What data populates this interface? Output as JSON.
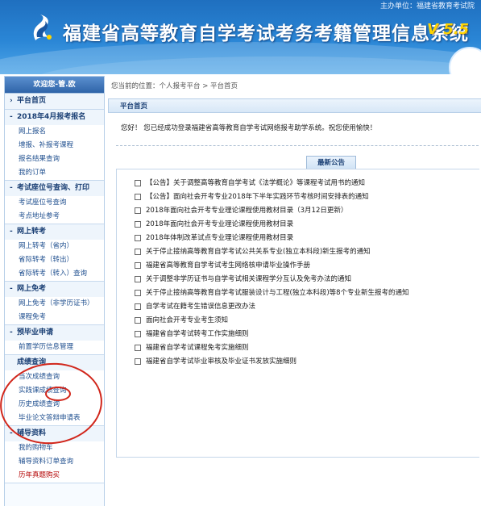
{
  "header": {
    "sponsor": "主办单位：福建省教育考试院",
    "title": "福建省高等教育自学考试考务考籍管理信息系统",
    "version": "V 5.5"
  },
  "sidebar": {
    "welcome": "欢迎您-管.欧",
    "groups": [
      {
        "title": "平台首页",
        "items": []
      },
      {
        "title": "2018年4月报考报名",
        "items": [
          "网上报名",
          "增报、补报考课程",
          "报名结果查询",
          "我的订单"
        ]
      },
      {
        "title": "考试座位号查询、打印",
        "items": [
          "考试座位号查询",
          "考点地址参考"
        ]
      },
      {
        "title": "网上转考",
        "items": [
          "网上转考（省内）",
          "省际转考（转出）",
          "省际转考（转入）查询"
        ]
      },
      {
        "title": "网上免考",
        "items": [
          "网上免考（非学历证书）",
          "课程免考"
        ]
      },
      {
        "title": "预毕业申请",
        "items": [
          "前置学历信息管理"
        ]
      },
      {
        "title": "成绩查询",
        "items": [
          "当次成绩查询",
          "实践课成绩查询",
          "历史成绩查询",
          "毕业论文答辩申请表"
        ]
      },
      {
        "title": "辅导资料",
        "items": [
          "我的购物车",
          "辅导资料订单查询",
          "历年真题购买"
        ]
      }
    ]
  },
  "main": {
    "breadcrumb": "您当前的位置：个人报考平台 > 平台首页",
    "tab_title": "平台首页",
    "welcome_message": "您好！ 您已经成功登录福建省高等教育自学考试网络报考助学系统。祝您使用愉快！",
    "notice_title": "最新公告",
    "notices": [
      "【公告】关于调整高等教育自学考试《法学概论》等课程考试用书的通知",
      "【公告】面向社会开考专业2018年下半年实践环节考核时间安排表的通知",
      "2018年面向社会开考专业理论课程使用教材目录（3月12日更新）",
      "2018年面向社会开考专业理论课程使用教材目录",
      "2018年体制改革试点专业理论课程使用教材目录",
      "关于停止接纳高等教育自学考试公共关系专业(独立本科段)新生报考的通知",
      "福建省高等教育自学考试考生网络核申请毕业操作手册",
      "关于调整非学历证书与自学考试相关课程学分互认及免考办法的通知",
      "关于停止接纳高等教育自学考试服装设计与工程(独立本科段)等8个专业新生报考的通知",
      "自学考试在籍考生错误信息更改办法",
      "面向社会开考专业考生须知",
      "福建省自学考试转考工作实施细则",
      "福建省自学考试课程免考实施细则",
      "福建省自学考试毕业审核及毕业证书发放实施细则"
    ]
  },
  "colors": {
    "header_blue": "#2a86d6",
    "version_yellow": "#ffd400",
    "annotation_red": "#d1261b",
    "link_blue": "#1f4f8f",
    "hot_red": "#b30000"
  }
}
